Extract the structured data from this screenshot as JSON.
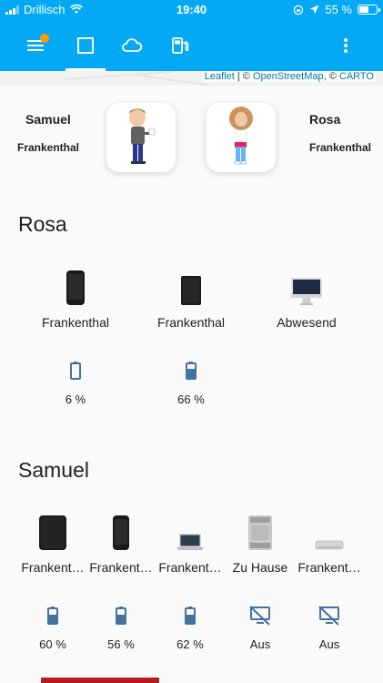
{
  "status_bar": {
    "carrier": "Drillisch",
    "time": "19:40",
    "battery_percent": "55 %",
    "battery_level": 0.55
  },
  "toolbar": {
    "icons": [
      "menu-icon",
      "square-icon",
      "cloud-icon",
      "fuel-pump-icon",
      "more-vertical-icon"
    ],
    "active_tab": 1,
    "accent": "#03a9f4",
    "badge_color": "#ff9800"
  },
  "map": {
    "attribution_leaflet": "Leaflet",
    "attribution_sep": " | © ",
    "attribution_osm": "OpenStreetMap",
    "attribution_sep2": ", © ",
    "attribution_carto": "CARTO"
  },
  "persons": [
    {
      "name": "Samuel",
      "location": "Frankenthal"
    },
    {
      "name": "Rosa",
      "location": "Frankenthal"
    }
  ],
  "rosa": {
    "title": "Rosa",
    "devices": [
      {
        "icon": "phone-icon",
        "label": "Frankenthal"
      },
      {
        "icon": "tablet-icon",
        "label": "Frankenthal"
      },
      {
        "icon": "imac-icon",
        "label": "Abwesend"
      }
    ],
    "batteries": [
      {
        "icon": "battery-low-icon",
        "label": "6 %",
        "level": 0.06
      },
      {
        "icon": "battery-icon",
        "label": "66 %",
        "level": 0.66
      }
    ]
  },
  "samuel": {
    "title": "Samuel",
    "devices": [
      {
        "icon": "tablet-icon",
        "label": "Frankent…"
      },
      {
        "icon": "phone-icon",
        "label": "Frankent…"
      },
      {
        "icon": "macbook-icon",
        "label": "Frankent…"
      },
      {
        "icon": "mac-pro-icon",
        "label": "Zu Hause"
      },
      {
        "icon": "mac-mini-icon",
        "label": "Frankent…"
      }
    ],
    "batteries": [
      {
        "icon": "battery-icon",
        "label": "60 %",
        "level": 0.6
      },
      {
        "icon": "battery-icon",
        "label": "56 %",
        "level": 0.56
      },
      {
        "icon": "battery-icon",
        "label": "62 %",
        "level": 0.62
      },
      {
        "icon": "monitor-off-icon",
        "label": "Aus"
      },
      {
        "icon": "monitor-off-icon",
        "label": "Aus"
      }
    ]
  }
}
